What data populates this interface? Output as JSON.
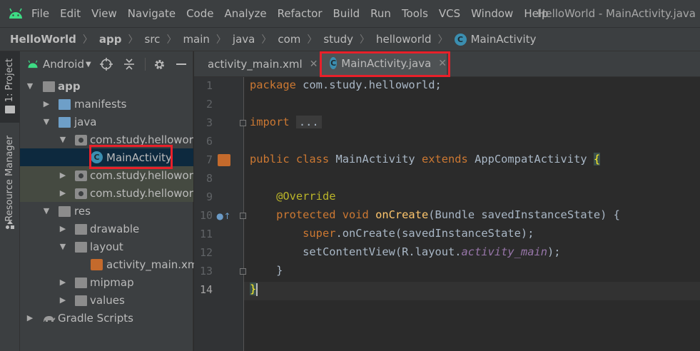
{
  "menu": {
    "items": [
      "File",
      "Edit",
      "View",
      "Navigate",
      "Code",
      "Analyze",
      "Refactor",
      "Build",
      "Run",
      "Tools",
      "VCS",
      "Window",
      "Help"
    ],
    "title": "HelloWorld - MainActivity.java"
  },
  "breadcrumb": {
    "items": [
      "HelloWorld",
      "app",
      "src",
      "main",
      "java",
      "com",
      "study",
      "helloworld",
      "MainActivity"
    ]
  },
  "leftstrip": {
    "project_label": "1: Project",
    "resource_label": "Resource Manager"
  },
  "panel": {
    "view_label": "Android"
  },
  "tree": [
    {
      "label": "app"
    },
    {
      "label": "manifests"
    },
    {
      "label": "java"
    },
    {
      "label": "com.study.helloworld"
    },
    {
      "label": "MainActivity"
    },
    {
      "label": "com.study.helloworld"
    },
    {
      "label": "com.study.helloworld"
    },
    {
      "label": "res"
    },
    {
      "label": "drawable"
    },
    {
      "label": "layout"
    },
    {
      "label": "activity_main.xml"
    },
    {
      "label": "mipmap"
    },
    {
      "label": "values"
    },
    {
      "label": "Gradle Scripts"
    }
  ],
  "tabs": [
    {
      "label": "activity_main.xml"
    },
    {
      "label": "MainActivity.java"
    }
  ],
  "editor": {
    "line_numbers": [
      "1",
      "2",
      "3",
      "6",
      "7",
      "8",
      "9",
      "10",
      "11",
      "12",
      "13",
      "14"
    ],
    "code": {
      "l1": {
        "kw": "package",
        "rest": " com.study.helloworld;"
      },
      "l3": {
        "kw": "import",
        "fold": "..."
      },
      "l7": {
        "kw1": "public class",
        "name": " MainActivity ",
        "kw2": "extends",
        "rest": " AppCompatActivity ",
        "brace": "{"
      },
      "l9": {
        "ann": "@Override"
      },
      "l10": {
        "kw": "protected void",
        "fn": "onCreate",
        "rest": "(Bundle savedInstanceState) {"
      },
      "l11": {
        "kw": "super",
        "rest": ".onCreate(savedInstanceState);"
      },
      "l12": {
        "pre": "setContentView(R.layout.",
        "ital": "activity_main",
        "post": ");"
      },
      "l13": {
        "text": "}"
      },
      "l14": {
        "text": "}"
      }
    }
  },
  "colors": {
    "accent": "#4a88c7",
    "highlight_box": "#e8202a"
  }
}
